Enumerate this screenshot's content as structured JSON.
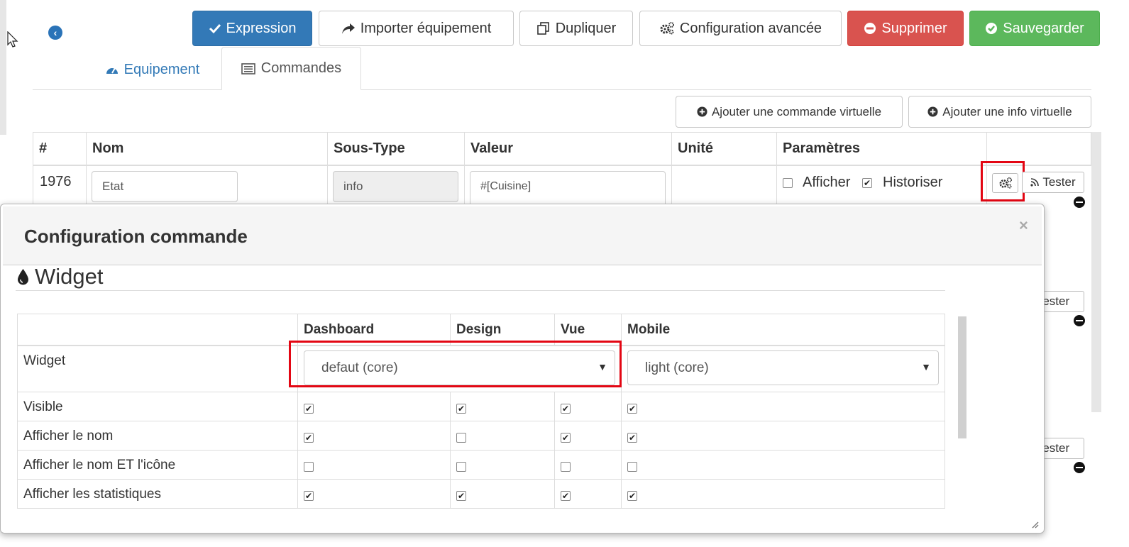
{
  "toolbar": {
    "expression": "Expression",
    "importer": "Importer équipement",
    "dupliquer": "Dupliquer",
    "config": "Configuration avancée",
    "supprimer": "Supprimer",
    "sauvegarder": "Sauvegarder",
    "colors": {
      "primary": "#3379b7",
      "danger": "#d9534f",
      "success": "#5cb85c"
    }
  },
  "tabs": {
    "equipement": "Equipement",
    "commandes": "Commandes"
  },
  "actions": {
    "add_cmd": "Ajouter une commande virtuelle",
    "add_info": "Ajouter une info virtuelle"
  },
  "table": {
    "headers": [
      "#",
      "Nom",
      "Sous-Type",
      "Valeur",
      "Unité",
      "Paramètres"
    ],
    "row": {
      "id": "1976",
      "nom": "Etat",
      "sous_type": "info",
      "valeur": "#[Cuisine]",
      "afficher": "Afficher",
      "historiser": "Historiser"
    },
    "tester": "Tester"
  },
  "modal": {
    "title": "Configuration commande",
    "close": "×",
    "section": "Widget",
    "columns": [
      "",
      "Dashboard",
      "Design",
      "Vue",
      "Mobile"
    ],
    "widget_label": "Widget",
    "dashboard_widget": "defaut (core)",
    "mobile_widget": "light (core)",
    "rows": [
      {
        "label": "Visible",
        "checks": [
          true,
          true,
          true,
          true
        ]
      },
      {
        "label": "Afficher le nom",
        "checks": [
          true,
          false,
          true,
          true
        ]
      },
      {
        "label": "Afficher le nom ET l'icône",
        "checks": [
          false,
          false,
          false,
          false
        ]
      },
      {
        "label": "Afficher les statistiques",
        "checks": [
          true,
          true,
          true,
          true
        ]
      }
    ]
  }
}
